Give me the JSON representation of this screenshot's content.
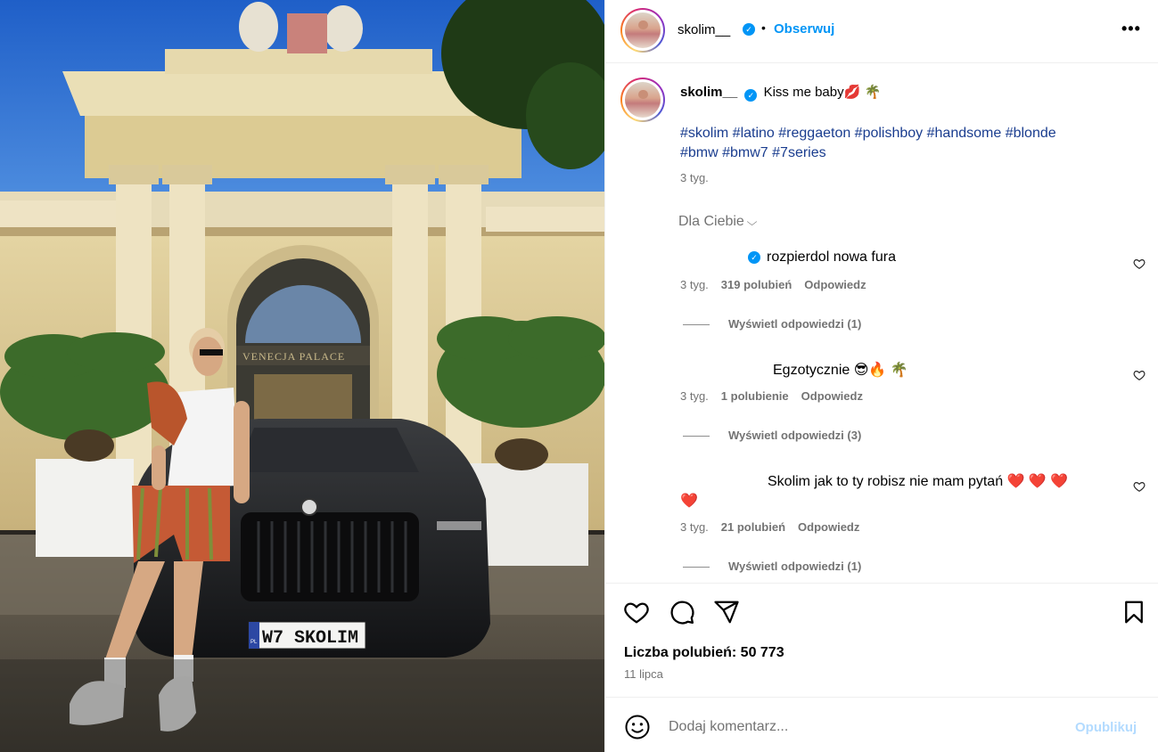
{
  "post": {
    "photo": {
      "plate": "W7 SKOLIM",
      "plate_country": "PL",
      "sign": "VENECJA PALACE"
    },
    "header": {
      "username": "skolim__",
      "separator": "•",
      "follow_label": "Obserwuj",
      "more_label": "•••"
    },
    "caption": {
      "username": "skolim__",
      "text": "Kiss me baby💋 🌴",
      "hashtags_line1": "#skolim #latino #reggaeton #polishboy #handsome #blonde",
      "hashtags_line2": "#bmw #bmw7 #7series",
      "time": "3 tyg."
    },
    "filter": {
      "label": "Dla Ciebie",
      "icon": "chevron-down-icon"
    },
    "comments": [
      {
        "text": "rozpierdol nowa fura",
        "time": "3 tyg.",
        "likes": "319 polubień",
        "reply_label": "Odpowiedz",
        "view_replies": "Wyświetl odpowiedzi (1)",
        "verified": true
      },
      {
        "text": "Egzotycznie 😎🔥 🌴",
        "time": "3 tyg.",
        "likes": "1 polubienie",
        "reply_label": "Odpowiedz",
        "view_replies": "Wyświetl odpowiedzi (3)",
        "verified": false
      },
      {
        "text": "Skolim jak to ty robisz nie mam pytań ❤️ ❤️ ❤️",
        "text_line2": "❤️",
        "time": "3 tyg.",
        "likes": "21 polubień",
        "reply_label": "Odpowiedz",
        "view_replies": "Wyświetl odpowiedzi (1)",
        "verified": false
      }
    ],
    "actions": {
      "likes_text": "Liczba polubień: 50 773",
      "date": "11 lipca",
      "icons": [
        "heart-icon",
        "comment-icon",
        "share-icon",
        "bookmark-icon"
      ]
    },
    "comment_box": {
      "placeholder": "Dodaj komentarz...",
      "publish_label": "Opublikuj"
    }
  },
  "colors": {
    "accent": "#0095f6",
    "hashtag": "#1a3d8f",
    "muted": "#737373",
    "publish_disabled": "#b3dbff"
  }
}
